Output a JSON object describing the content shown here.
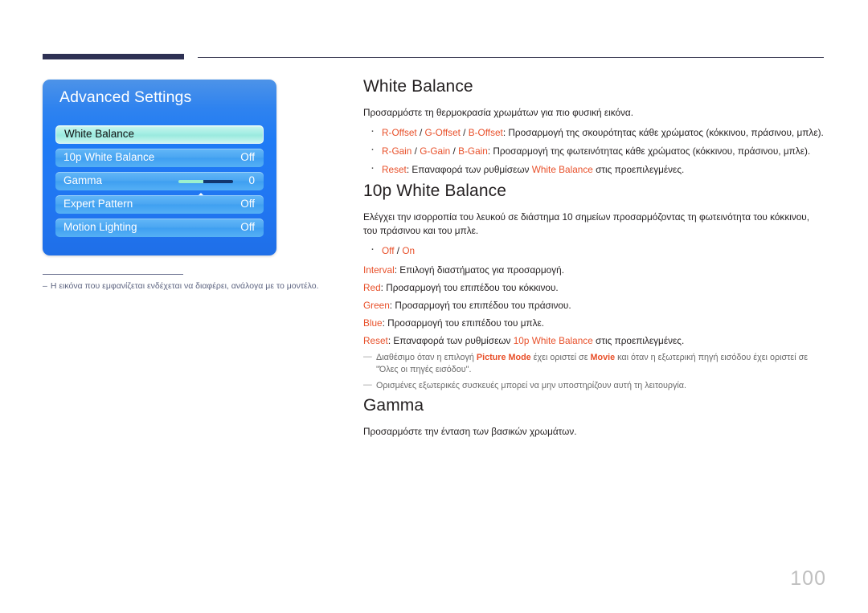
{
  "page": {
    "number": "100"
  },
  "osd": {
    "title": "Advanced Settings",
    "rows": [
      {
        "label": "White Balance",
        "value": "",
        "selected": true,
        "slider": false
      },
      {
        "label": "10p White Balance",
        "value": "Off",
        "selected": false,
        "slider": false
      },
      {
        "label": "Gamma",
        "value": "0",
        "selected": false,
        "slider": true
      },
      {
        "label": "Expert Pattern",
        "value": "Off",
        "selected": false,
        "slider": false
      },
      {
        "label": "Motion Lighting",
        "value": "Off",
        "selected": false,
        "slider": false
      }
    ],
    "caption_dash": "–",
    "caption": "Η εικόνα που εμφανίζεται ενδέχεται να διαφέρει, ανάλογα με το μοντέλο."
  },
  "sections": {
    "white_balance": {
      "heading": "White Balance",
      "lead": "Προσαρμόστε τη θερμοκρασία χρωμάτων για πιο φυσική εικόνα.",
      "bullets": [
        {
          "key": "R-Offset / G-Offset / B-Offset",
          "key_parts": [
            "R-Offset",
            " / ",
            "G-Offset",
            " / ",
            "B-Offset"
          ],
          "text": ": Προσαρμογή της σκουρότητας κάθε χρώματος (κόκκινου, πράσινου, μπλε)."
        },
        {
          "key": "R-Gain / G-Gain / B-Gain",
          "key_parts": [
            "R-Gain",
            " / ",
            "G-Gain",
            " / ",
            "B-Gain"
          ],
          "text": ": Προσαρμογή της φωτεινότητας κάθε χρώματος (κόκκινου, πράσινου, μπλε)."
        },
        {
          "key": "Reset",
          "text_before": ": Επαναφορά των ρυθμίσεων ",
          "inline_hl": "White Balance",
          "text_after": " στις προεπιλεγμένες."
        }
      ]
    },
    "tenp_white_balance": {
      "heading": "10p White Balance",
      "lead": "Ελέγχει την ισορροπία του λευκού σε διάστημα 10 σημείων προσαρμόζοντας τη φωτεινότητα του κόκκινου, του πράσινου και του μπλε.",
      "bullet_off": "Off",
      "bullet_sep": " / ",
      "bullet_on": "On",
      "lines": [
        {
          "key": "Interval",
          "text": ": Επιλογή διαστήματος για προσαρμογή."
        },
        {
          "key": "Red",
          "text": ": Προσαρμογή του επιπέδου του κόκκινου."
        },
        {
          "key": "Green",
          "text": ": Προσαρμογή του επιπέδου του πράσινου."
        },
        {
          "key": "Blue",
          "text": ": Προσαρμογή του επιπέδου του μπλε."
        }
      ],
      "reset_key": "Reset",
      "reset_before": ": Επαναφορά των ρυθμίσεων ",
      "reset_inline_hl": "10p White Balance",
      "reset_after": " στις προεπιλεγμένες.",
      "notes": [
        {
          "dash": "—",
          "p1": "Διαθέσιμο όταν η επιλογή ",
          "hl1": "Picture Mode",
          "p2": " έχει οριστεί σε ",
          "hl2": "Movie",
          "p3": " και όταν η εξωτερική πηγή εισόδου έχει οριστεί σε \"Όλες οι πηγές εισόδου\"."
        },
        {
          "dash": "—",
          "p1": "Ορισμένες εξωτερικές συσκευές μπορεί να μην υποστηρίζουν αυτή τη λειτουργία.",
          "hl1": "",
          "p2": "",
          "hl2": "",
          "p3": ""
        }
      ]
    },
    "gamma": {
      "heading": "Gamma",
      "lead": "Προσαρμόστε την ένταση των βασικών χρωμάτων."
    }
  },
  "colors": {
    "accent_red": "#e8502a",
    "panel_blue": "#1f7bf5",
    "row_blue": "#4aa6f2",
    "selected_row": "#a6eee4",
    "header_bar": "#2e3154",
    "page_number": "#bfbfbf"
  }
}
